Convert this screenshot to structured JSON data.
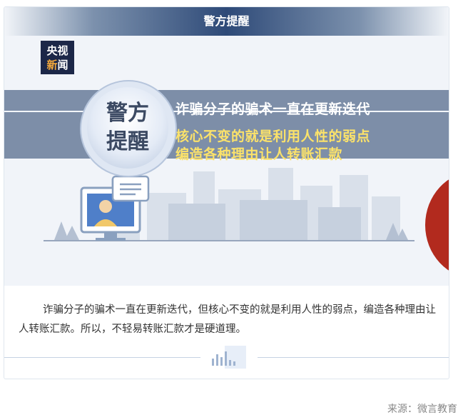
{
  "card": {
    "header_title": "警方提醒"
  },
  "hero": {
    "logo_line1": "央视",
    "logo_line2_a": "新",
    "logo_line2_b": "闻",
    "badge_line1": "警方",
    "badge_line2": "提醒",
    "banner_line1": "诈骗分子的骗术一直在更新迭代",
    "banner_line2": "核心不变的就是利用人性的弱点",
    "banner_line3": "编造各种理由让人转账汇款"
  },
  "article": {
    "paragraph": "诈骗分子的骗术一直在更新迭代，但核心不变的就是利用人性的弱点，编造各种理由让人转账汇款。所以，不轻易转账汇款才是硬道理。"
  },
  "footer": {
    "source": "来源：微言教育"
  },
  "colors": {
    "header_dark": "#2e4a78",
    "banner": "#7d8ea8",
    "highlight_text": "#fbe26a",
    "red_accent": "#b22a1e"
  },
  "icons": [
    "computer-monitor-icon",
    "user-avatar-icon",
    "chat-bubble-icon",
    "tree-icon",
    "bar-chart-icon"
  ]
}
